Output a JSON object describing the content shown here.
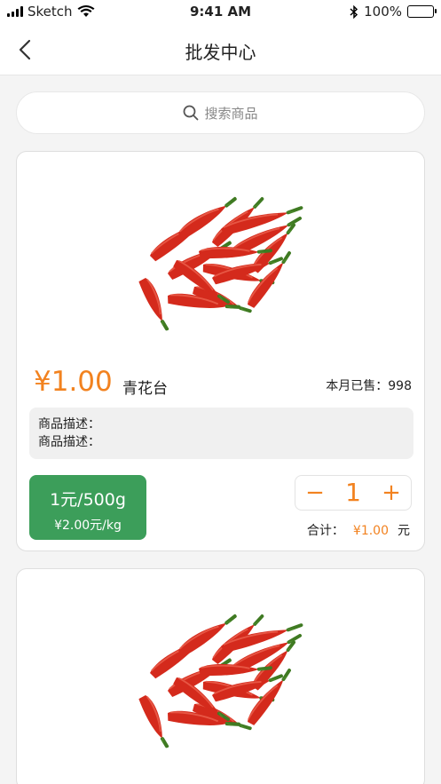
{
  "status_bar": {
    "carrier": "Sketch",
    "time": "9:41 AM",
    "battery": "100%"
  },
  "nav": {
    "title": "批发中心"
  },
  "search": {
    "placeholder": "搜索商品"
  },
  "products": [
    {
      "price": "¥1.00",
      "name": "青花台",
      "sold": "本月已售：998",
      "desc_line1": "商品描述：",
      "desc_line2": "商品描述：",
      "unit_main": "1元/500g",
      "unit_sub": "¥2.00元/kg",
      "qty": "1",
      "minus": "−",
      "plus": "+",
      "total_label": "合计：",
      "total_amount": "¥1.00",
      "total_unit": "元"
    }
  ],
  "colors": {
    "accent": "#f2821f",
    "green": "#3c9e5a"
  },
  "icons": {
    "back": "chevron-left-icon",
    "search": "search-icon",
    "wifi": "wifi-icon",
    "bluetooth": "bluetooth-icon"
  }
}
